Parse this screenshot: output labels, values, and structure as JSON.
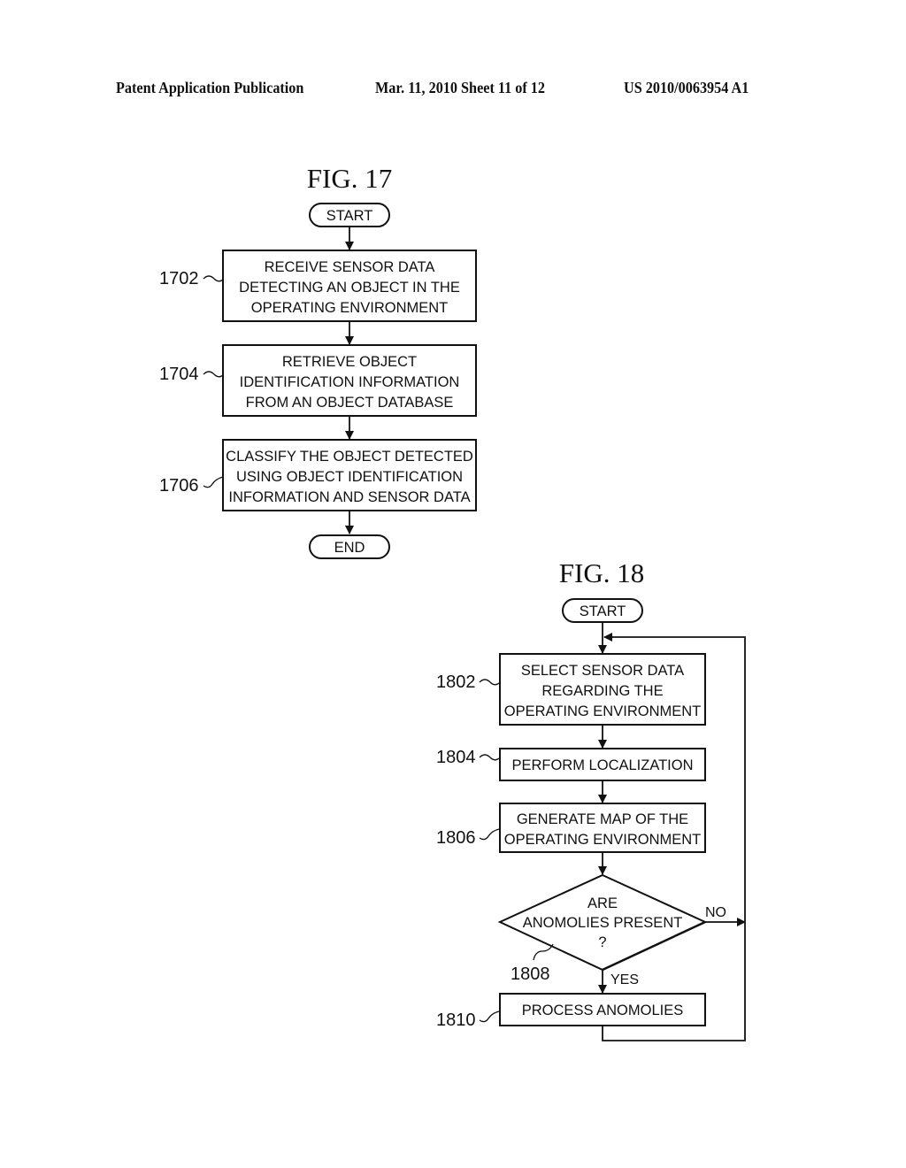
{
  "header": {
    "publication": "Patent Application Publication",
    "date_sheet": "Mar. 11, 2010  Sheet 11 of 12",
    "number": "US 2010/0063954 A1"
  },
  "fig17": {
    "title": "FIG. 17",
    "start": "START",
    "end": "END",
    "steps": [
      {
        "ref": "1702",
        "lines": [
          "RECEIVE SENSOR DATA",
          "DETECTING AN OBJECT IN THE",
          "OPERATING ENVIRONMENT"
        ]
      },
      {
        "ref": "1704",
        "lines": [
          "RETRIEVE OBJECT",
          "IDENTIFICATION INFORMATION",
          "FROM AN OBJECT DATABASE"
        ]
      },
      {
        "ref": "1706",
        "lines": [
          "CLASSIFY THE OBJECT DETECTED",
          "USING OBJECT IDENTIFICATION",
          "INFORMATION AND SENSOR DATA"
        ]
      }
    ]
  },
  "fig18": {
    "title": "FIG. 18",
    "start": "START",
    "steps": [
      {
        "ref": "1802",
        "lines": [
          "SELECT SENSOR DATA",
          "REGARDING THE",
          "OPERATING ENVIRONMENT"
        ]
      },
      {
        "ref": "1804",
        "lines": [
          "PERFORM LOCALIZATION"
        ]
      },
      {
        "ref": "1806",
        "lines": [
          "GENERATE MAP OF THE",
          "OPERATING ENVIRONMENT"
        ]
      }
    ],
    "decision": {
      "ref": "1808",
      "lines": [
        "ARE",
        "ANOMOLIES PRESENT",
        "?"
      ],
      "no_label": "NO",
      "yes_label": "YES"
    },
    "final": {
      "ref": "1810",
      "lines": [
        "PROCESS ANOMOLIES"
      ]
    }
  }
}
